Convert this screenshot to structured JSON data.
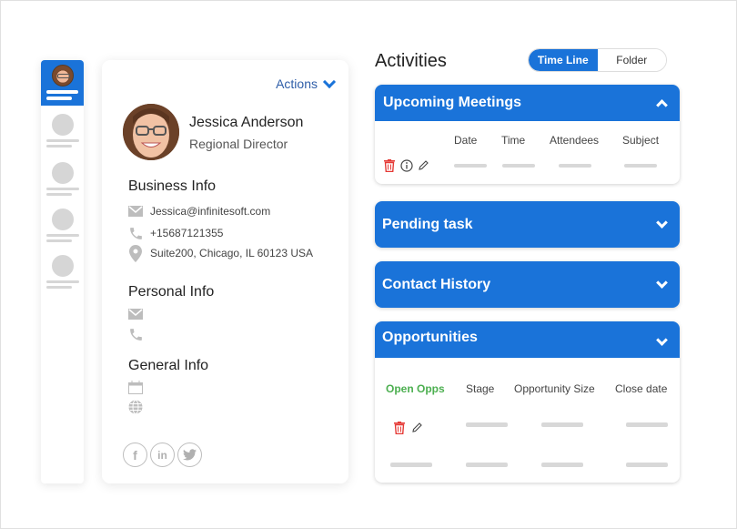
{
  "profile": {
    "actions_label": "Actions",
    "name": "Jessica Anderson",
    "role": "Regional Director",
    "business_info": {
      "heading": "Business Info",
      "email": "Jessica@infinitesoft.com",
      "phone": "+15687121355",
      "address": "Suite200, Chicago, IL 60123 USA"
    },
    "personal_info": {
      "heading": "Personal Info"
    },
    "general_info": {
      "heading": "General Info"
    },
    "socials": [
      "facebook",
      "linkedin",
      "twitter"
    ]
  },
  "activities": {
    "title": "Activities",
    "view_toggle": {
      "options": [
        "Time Line",
        "Folder"
      ],
      "selected": "Time Line"
    },
    "panels": [
      {
        "title": "Upcoming Meetings",
        "expanded": true,
        "columns": [
          "Date",
          "Time",
          "Attendees",
          "Subject"
        ]
      },
      {
        "title": "Pending task",
        "expanded": false
      },
      {
        "title": "Contact History",
        "expanded": false
      },
      {
        "title": "Opportunities",
        "expanded": true,
        "columns": [
          "Open Opps",
          "Stage",
          "Opportunity Size",
          "Close date"
        ]
      }
    ]
  },
  "colors": {
    "accent": "#1a73d9",
    "delete": "#e53935",
    "open_opps": "#4caf50"
  }
}
